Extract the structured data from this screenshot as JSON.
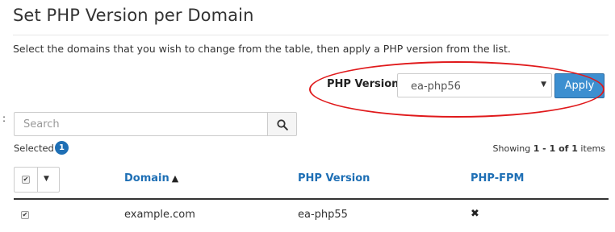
{
  "page": {
    "title": "Set PHP Version per Domain",
    "description": "Select the domains that you wish to change from the table, then apply a PHP version from the list."
  },
  "php_selector": {
    "label": "PHP Version",
    "selected": "ea-php56",
    "apply_label": "Apply"
  },
  "side_mark": ":",
  "search": {
    "placeholder": "Search"
  },
  "selection": {
    "label": "Selected",
    "count": "1"
  },
  "pagination": {
    "prefix": "Showing ",
    "range": "1 - 1 of 1",
    "suffix": " items"
  },
  "table": {
    "columns": {
      "domain": "Domain",
      "php_version": "PHP Version",
      "php_fpm": "PHP-FPM"
    },
    "rows": [
      {
        "checked": true,
        "domain": "example.com",
        "php_version": "ea-php55",
        "php_fpm": "✖"
      }
    ]
  },
  "colors": {
    "accent": "#1e6fb5",
    "apply_button": "#3d8fd0",
    "highlight": "#e0191b"
  },
  "icons": {
    "search": "magnifier",
    "sort": "▲",
    "caret": "▼",
    "check": "✔"
  }
}
